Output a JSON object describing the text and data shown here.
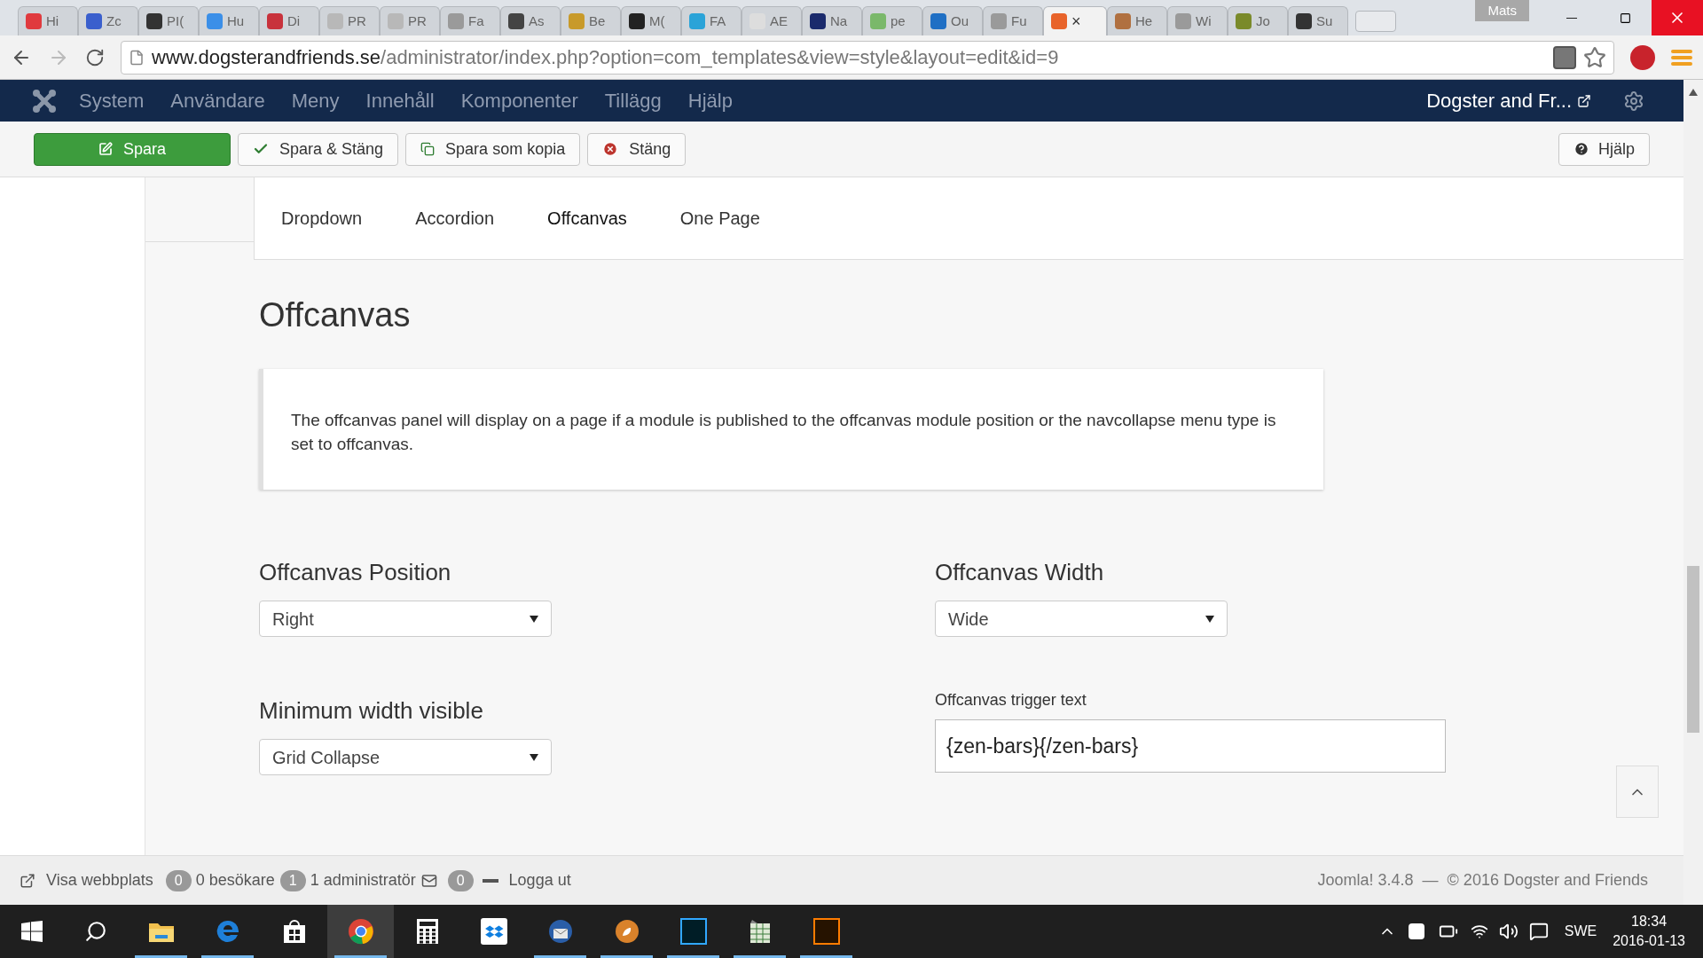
{
  "browser": {
    "tabs": [
      {
        "label": "Hi",
        "color": "#e03a3e",
        "selected": false
      },
      {
        "label": "Zc",
        "color": "#3a5fcd",
        "selected": false
      },
      {
        "label": "PI(",
        "color": "#333333",
        "selected": false
      },
      {
        "label": "Hu",
        "color": "#3b8fe8",
        "selected": false
      },
      {
        "label": "Di",
        "color": "#c8323c",
        "selected": false
      },
      {
        "label": "PR",
        "color": "#b8b8b8",
        "selected": false
      },
      {
        "label": "PR",
        "color": "#b8b8b8",
        "selected": false
      },
      {
        "label": "Fa",
        "color": "#9a9a9a",
        "selected": false
      },
      {
        "label": "As",
        "color": "#444444",
        "selected": false
      },
      {
        "label": "Be",
        "color": "#c89a2a",
        "selected": false
      },
      {
        "label": "M(",
        "color": "#222222",
        "selected": false
      },
      {
        "label": "FA",
        "color": "#2aa3d8",
        "selected": false
      },
      {
        "label": "AE",
        "color": "#dddddd",
        "selected": false
      },
      {
        "label": "Na",
        "color": "#1a2a6c",
        "selected": false
      },
      {
        "label": "pe",
        "color": "#7ab86a",
        "selected": false
      },
      {
        "label": "Ou",
        "color": "#1f6fc4",
        "selected": false
      },
      {
        "label": "Fu",
        "color": "#9a9a9a",
        "selected": false
      },
      {
        "label": "×",
        "color": "#e8632a",
        "selected": true
      },
      {
        "label": "He",
        "color": "#b07040",
        "selected": false
      },
      {
        "label": "Wi",
        "color": "#9a9a9a",
        "selected": false
      },
      {
        "label": "Jo",
        "color": "#7a8a2a",
        "selected": false
      },
      {
        "label": "Su",
        "color": "#333333",
        "selected": false
      }
    ],
    "user": "Mats",
    "url_host": "www.dogsterandfriends.se",
    "url_path": "/administrator/index.php?option=com_templates&view=style&layout=edit&id=9"
  },
  "navbar": {
    "menu": [
      "System",
      "Användare",
      "Meny",
      "Innehåll",
      "Komponenter",
      "Tillägg",
      "Hjälp"
    ],
    "site": "Dogster and Fr..."
  },
  "toolbar": {
    "buttons": [
      {
        "label": "Spara",
        "kind": "primary"
      },
      {
        "label": "Spara & Stäng",
        "kind": "check"
      },
      {
        "label": "Spara som kopia",
        "kind": "copy"
      },
      {
        "label": "Stäng",
        "kind": "close"
      }
    ],
    "help": "Hjälp"
  },
  "subtabs": [
    {
      "label": "Dropdown",
      "selected": false
    },
    {
      "label": "Accordion",
      "selected": false
    },
    {
      "label": "Offcanvas",
      "selected": true
    },
    {
      "label": "One Page",
      "selected": false
    }
  ],
  "section": {
    "title": "Offcanvas",
    "note": "The offcanvas panel will display on a page if a module is published to the offcanvas module position or the navcollapse menu type is set to offcanvas.",
    "fields": [
      {
        "label": "Offcanvas Position",
        "kind": "select",
        "value": "Right"
      },
      {
        "label": "Offcanvas Width",
        "kind": "select",
        "value": "Wide"
      },
      {
        "label": "Minimum width visible",
        "kind": "select",
        "value": "Grid Collapse"
      },
      {
        "label": "Offcanvas trigger text",
        "kind": "text",
        "value": "{zen-bars}{/zen-bars}"
      }
    ]
  },
  "status_bar": {
    "view_site": "Visa webbplats",
    "visitors_count": "0",
    "visitors": "0 besökare",
    "admins_count": "1",
    "admins": "1 administratör",
    "messages_count": "0",
    "logout": "Logga ut",
    "version": "Joomla! 3.4.8",
    "separator": "—",
    "copyright": "© 2016 Dogster and Friends"
  },
  "taskbar": {
    "apps": [
      {
        "kind": "folder",
        "running": true,
        "selected": false
      },
      {
        "kind": "edge",
        "running": true,
        "selected": false
      },
      {
        "kind": "store",
        "running": false,
        "selected": false
      },
      {
        "kind": "chrome",
        "running": true,
        "selected": true
      },
      {
        "kind": "calculator",
        "running": false,
        "selected": false
      },
      {
        "kind": "dropbox",
        "running": false,
        "selected": false
      },
      {
        "kind": "mail",
        "running": true,
        "selected": false
      },
      {
        "kind": "orange",
        "running": true,
        "selected": false
      },
      {
        "kind": "ps",
        "running": true,
        "selected": false
      },
      {
        "kind": "sheet",
        "running": true,
        "selected": false
      },
      {
        "kind": "ai",
        "running": true,
        "selected": false
      }
    ],
    "lang": "SWE",
    "time": "18:34",
    "date": "2016-01-13"
  }
}
